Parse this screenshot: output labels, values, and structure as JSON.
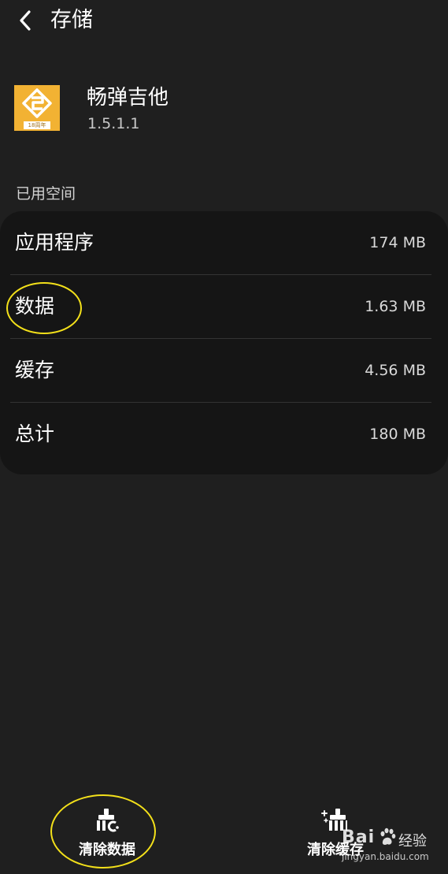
{
  "header": {
    "back_icon": "chevron-left-icon",
    "title": "存储"
  },
  "app": {
    "icon_name": "app-logo-icon",
    "icon_badge": "18周年",
    "name": "畅弹吉他",
    "version": "1.5.1.1"
  },
  "section_label": "已用空间",
  "storage_rows": [
    {
      "label": "应用程序",
      "value": "174 MB"
    },
    {
      "label": "数据",
      "value": "1.63 MB"
    },
    {
      "label": "缓存",
      "value": "4.56 MB"
    },
    {
      "label": "总计",
      "value": "180 MB"
    }
  ],
  "actions": {
    "clear_data": {
      "label": "清除数据",
      "icon": "brush-clear-icon"
    },
    "clear_cache": {
      "label": "清除缓存",
      "icon": "broom-sparkle-icon"
    }
  },
  "watermark": {
    "brand": "Bai",
    "cn": "经验",
    "url": "jingyan.baidu.com"
  },
  "colors": {
    "background": "#1f1f1f",
    "card": "#151515",
    "annotation": "#f3e01a",
    "app_icon": "#f2b233"
  }
}
